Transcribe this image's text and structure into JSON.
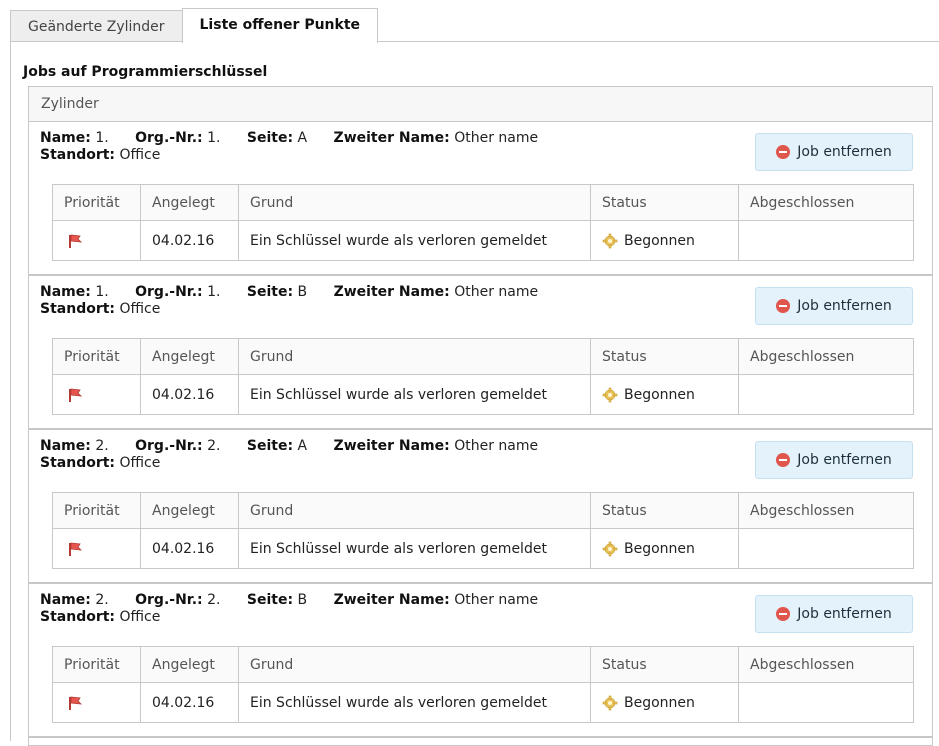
{
  "tabs": [
    {
      "label": "Geänderte Zylinder"
    },
    {
      "label": "Liste offener Punkte"
    }
  ],
  "section_title": "Jobs auf Programmierschlüssel",
  "list_header": "Zylinder",
  "labels": {
    "name": "Name:",
    "org": "Org.-Nr.:",
    "side": "Seite:",
    "second_name": "Zweiter Name:",
    "location": "Standort:",
    "remove_button": "Job entfernen"
  },
  "columns": [
    "Priorität",
    "Angelegt",
    "Grund",
    "Status",
    "Abgeschlossen"
  ],
  "icons": {
    "priority": "flag-icon",
    "status": "gear-icon",
    "remove": "minus-circle-icon"
  },
  "colors": {
    "button_bg": "#e3f2fb",
    "remove_icon": "#e0564d",
    "flag": "#e8554f",
    "gear": "#e8c35a"
  },
  "jobs": [
    {
      "name": "1.",
      "org": "1.",
      "side": "A",
      "second_name": "Other name",
      "location": "Office",
      "rows": [
        {
          "created": "04.02.16",
          "reason": "Ein Schlüssel wurde als verloren gemeldet",
          "status": "Begonnen",
          "completed": ""
        }
      ]
    },
    {
      "name": "1.",
      "org": "1.",
      "side": "B",
      "second_name": "Other name",
      "location": "Office",
      "rows": [
        {
          "created": "04.02.16",
          "reason": "Ein Schlüssel wurde als verloren gemeldet",
          "status": "Begonnen",
          "completed": ""
        }
      ]
    },
    {
      "name": "2.",
      "org": "2.",
      "side": "A",
      "second_name": "Other name",
      "location": "Office",
      "rows": [
        {
          "created": "04.02.16",
          "reason": "Ein Schlüssel wurde als verloren gemeldet",
          "status": "Begonnen",
          "completed": ""
        }
      ]
    },
    {
      "name": "2.",
      "org": "2.",
      "side": "B",
      "second_name": "Other name",
      "location": "Office",
      "rows": [
        {
          "created": "04.02.16",
          "reason": "Ein Schlüssel wurde als verloren gemeldet",
          "status": "Begonnen",
          "completed": ""
        }
      ]
    }
  ]
}
